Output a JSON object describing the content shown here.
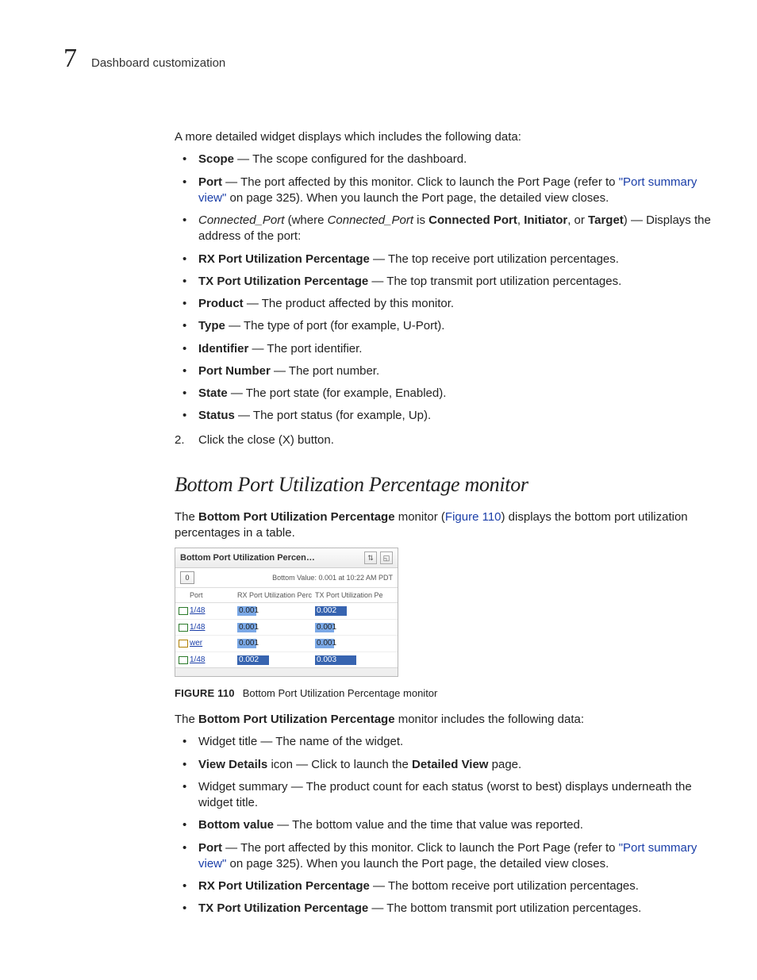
{
  "header": {
    "chapter_number": "7",
    "chapter_title": "Dashboard customization"
  },
  "intro": "A more detailed widget displays which includes the following data:",
  "bullets1": [
    {
      "term": "Scope",
      "desc": " — The scope configured for the dashboard."
    },
    {
      "term": "Port",
      "desc_pre": " — The port affected by this monitor. Click to launch the Port Page (refer to ",
      "link": "\"Port summary view\"",
      "desc_post": " on page 325). When you launch the Port page, the detailed view closes."
    },
    {
      "italic": "Connected_Port",
      "mid": " (where ",
      "italic2": "Connected_Port",
      "mid2": " is ",
      "b1": "Connected Port",
      "sep1": ", ",
      "b2": "Initiator",
      "sep2": ", or ",
      "b3": "Target",
      "desc": ") — Displays the address of the port:"
    },
    {
      "term": "RX Port Utilization Percentage",
      "desc": " — The top receive port utilization percentages."
    },
    {
      "term": "TX Port Utilization Percentage",
      "desc": " — The top transmit port utilization percentages."
    },
    {
      "term": "Product",
      "desc": " — The product affected by this monitor."
    },
    {
      "term": "Type",
      "desc": " — The type of port (for example, U-Port)."
    },
    {
      "term": "Identifier",
      "desc": " — The port identifier."
    },
    {
      "term": "Port Number",
      "desc": " — The port number."
    },
    {
      "term": "State",
      "desc": " — The port state (for example, Enabled)."
    },
    {
      "term": "Status",
      "desc": " — The port status (for example, Up)."
    }
  ],
  "step2": {
    "num": "2.",
    "text": "Click the close (X) button."
  },
  "section_title": "Bottom Port Utilization Percentage monitor",
  "section_intro": {
    "pre": "The ",
    "bold": "Bottom Port Utilization Percentage",
    "mid": " monitor (",
    "figlink": "Figure 110",
    "post": ") displays the bottom port utilization percentages in a table."
  },
  "widget": {
    "title": "Bottom Port Utilization Percen…",
    "count": "0",
    "subtitle": "Bottom Value: 0.001 at 10:22 AM PDT",
    "cols": [
      "",
      "Port",
      "RX Port Utilization Perc",
      "TX Port Utilization Pe"
    ],
    "rows": [
      {
        "port": "1/48",
        "rx": "0.001",
        "tx": "0.002",
        "rx_hl": false,
        "tx_hl": true,
        "rx_w": 24,
        "tx_w": 40,
        "warn": false
      },
      {
        "port": "1/48",
        "rx": "0.001",
        "tx": "0.001",
        "rx_hl": false,
        "tx_hl": false,
        "rx_w": 24,
        "tx_w": 24,
        "warn": false
      },
      {
        "port": "wer",
        "rx": "0.001",
        "tx": "0.001",
        "rx_hl": false,
        "tx_hl": false,
        "rx_w": 24,
        "tx_w": 24,
        "warn": true
      },
      {
        "port": "1/48",
        "rx": "0.002",
        "tx": "0.003",
        "rx_hl": true,
        "tx_hl": true,
        "rx_w": 40,
        "tx_w": 52,
        "warn": false
      }
    ]
  },
  "fig_caption": {
    "label": "FIGURE 110",
    "text": "Bottom Port Utilization Percentage monitor"
  },
  "section_intro2": {
    "pre": "The ",
    "bold": "Bottom Port Utilization Percentage",
    "post": " monitor includes the following data:"
  },
  "bullets2": [
    {
      "plain": "Widget title — The name of the widget."
    },
    {
      "b1": "View Details",
      "mid": " icon — Click to launch the ",
      "b2": "Detailed View",
      "post": " page."
    },
    {
      "plain": "Widget summary — The product count for each status (worst to best) displays underneath the widget title."
    },
    {
      "term": "Bottom value",
      "desc": " — The bottom value and the time that value was reported."
    },
    {
      "term": "Port",
      "desc_pre": " — The port affected by this monitor. Click to launch the Port Page (refer to ",
      "link": "\"Port summary view\"",
      "desc_post": " on page 325). When you launch the Port page, the detailed view closes."
    },
    {
      "term": "RX Port Utilization Percentage",
      "desc": " — The bottom receive port utilization percentages."
    },
    {
      "term": "TX Port Utilization Percentage",
      "desc": " — The bottom transmit port utilization percentages."
    }
  ]
}
